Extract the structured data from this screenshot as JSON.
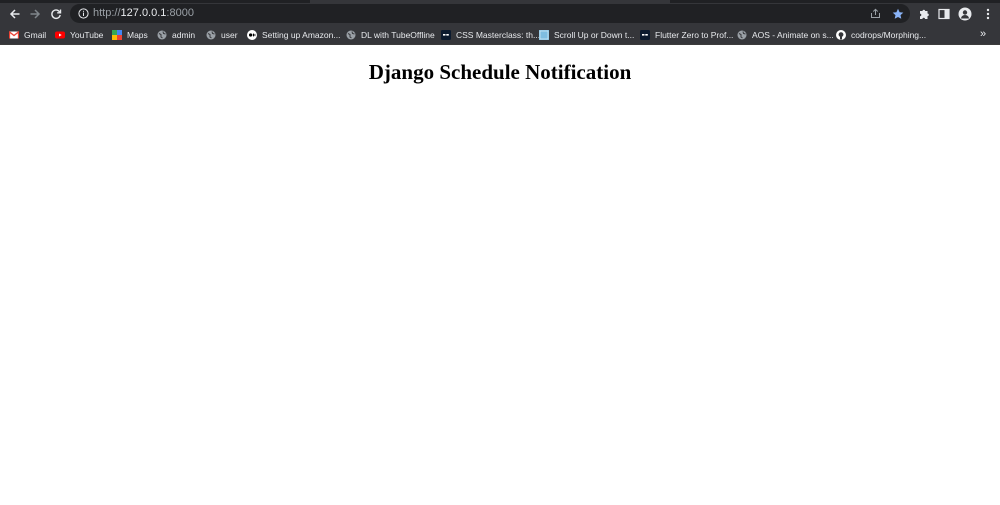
{
  "browser": {
    "url_scheme": "http://",
    "url_host": "127.0.0.1",
    "url_port": ":8000",
    "bookmarks": [
      {
        "label": "Gmail",
        "icon": "gmail-icon"
      },
      {
        "label": "YouTube",
        "icon": "youtube-icon"
      },
      {
        "label": "Maps",
        "icon": "maps-icon"
      },
      {
        "label": "admin",
        "icon": "globe-icon"
      },
      {
        "label": "user",
        "icon": "globe-icon"
      },
      {
        "label": "Setting up Amazon...",
        "icon": "medium-icon"
      },
      {
        "label": "DL with TubeOffline",
        "icon": "globe-icon"
      },
      {
        "label": "CSS Masterclass: th...",
        "icon": "sk-icon"
      },
      {
        "label": "Scroll Up or Down t...",
        "icon": "image-icon"
      },
      {
        "label": "Flutter Zero to Prof...",
        "icon": "sk-icon"
      },
      {
        "label": "AOS - Animate on s...",
        "icon": "globe-icon"
      },
      {
        "label": "codrops/Morphing...",
        "icon": "github-icon"
      }
    ],
    "more_bookmarks": "»",
    "colors": {
      "frame": "#35363a",
      "omnibox": "#202124",
      "star": "#8ab4f8"
    }
  },
  "page": {
    "title": "Django Schedule Notification"
  }
}
